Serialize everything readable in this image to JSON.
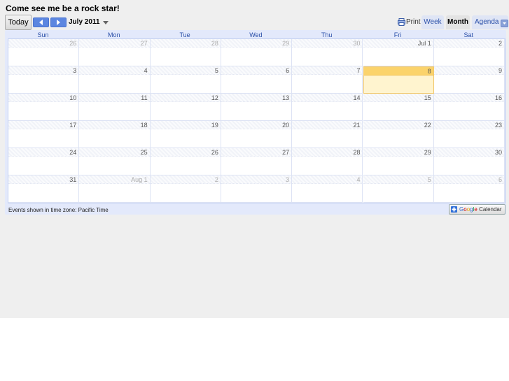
{
  "header": {
    "title": "Come see me be a rock star!"
  },
  "toolbar": {
    "today_label": "Today",
    "date_label": "July 2011",
    "print_label": "Print",
    "tabs": {
      "week": "Week",
      "month": "Month",
      "agenda": "Agenda"
    },
    "active_tab": "Month"
  },
  "calendar": {
    "day_headers": [
      "Sun",
      "Mon",
      "Tue",
      "Wed",
      "Thu",
      "Fri",
      "Sat"
    ],
    "weeks": [
      [
        "26",
        "27",
        "28",
        "29",
        "30",
        "Jul 1",
        "2"
      ],
      [
        "3",
        "4",
        "5",
        "6",
        "7",
        "8",
        "9"
      ],
      [
        "10",
        "11",
        "12",
        "13",
        "14",
        "15",
        "16"
      ],
      [
        "17",
        "18",
        "19",
        "20",
        "21",
        "22",
        "23"
      ],
      [
        "24",
        "25",
        "26",
        "27",
        "28",
        "29",
        "30"
      ],
      [
        "31",
        "Aug 1",
        "2",
        "3",
        "4",
        "5",
        "6"
      ]
    ],
    "today": "8",
    "colors": {
      "accent": "#5c86e0",
      "header_text": "#2a4fa8",
      "today_bg": "#fff4cf",
      "today_head": "#fbd36b",
      "frame_bg": "#e3e9fb"
    }
  },
  "footer": {
    "timezone_text": "Events shown in time zone: Pacific Time",
    "badge": {
      "google_letters": [
        "G",
        "o",
        "o",
        "g",
        "l",
        "e"
      ],
      "calendar_label": "Calendar",
      "icon": "plus-icon"
    }
  }
}
